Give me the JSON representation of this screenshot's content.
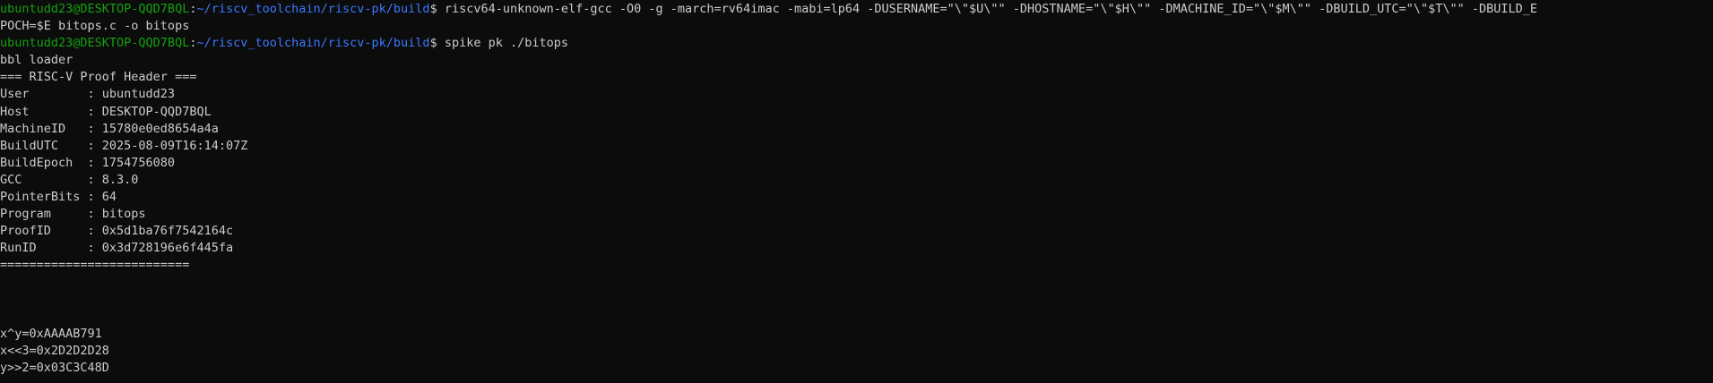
{
  "terminal": {
    "prompt": {
      "userhost": "ubuntudd23@DESKTOP-QQD7BQL",
      "colon": ":",
      "cwd": "~/riscv_toolchain/riscv-pk/build",
      "dollar": "$ "
    },
    "commands": {
      "compile_part1": "riscv64-unknown-elf-gcc -O0 -g -march=rv64imac -mabi=lp64 -DUSERNAME=\"\\\"$U\\\"\" -DHOSTNAME=\"\\\"$H\\\"\" -DMACHINE_ID=\"\\\"$M\\\"\" -DBUILD_UTC=\"\\\"$T\\\"\" -DBUILD_E",
      "compile_part2": "POCH=$E bitops.c -o bitops",
      "run": "spike pk ./bitops"
    },
    "output": {
      "loader": "bbl loader",
      "header_title": "=== RISC-V Proof Header ===",
      "fields": [
        "User        : ubuntudd23",
        "Host        : DESKTOP-QQD7BQL",
        "MachineID   : 15780e0ed8654a4a",
        "BuildUTC    : 2025-08-09T16:14:07Z",
        "BuildEpoch  : 1754756080",
        "GCC         : 8.3.0",
        "PointerBits : 64",
        "Program     : bitops",
        "ProofID     : 0x5d1ba76f7542164c",
        "RunID       : 0x3d728196e6f445fa"
      ],
      "header_footer": "==========================",
      "results": [
        "x^y=0xAAAAB791",
        "x<<3=0x2D2D2D28",
        "y>>2=0x03C3C48D"
      ]
    }
  }
}
